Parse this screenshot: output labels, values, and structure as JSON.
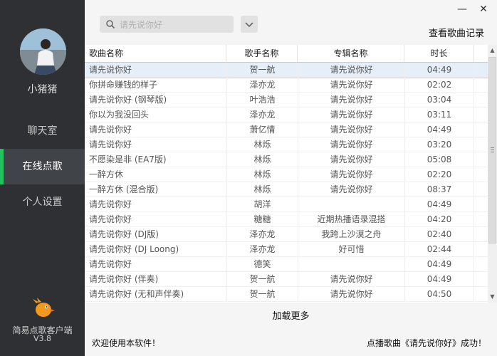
{
  "sidebar": {
    "username": "小猪猪",
    "nav": [
      "聊天室",
      "在线点歌",
      "个人设置"
    ],
    "active_nav": "在线点歌",
    "app_name": "简易点歌客户端",
    "app_version": "V3.8"
  },
  "window": {
    "minimize_label": "—",
    "close_label": "✕"
  },
  "search": {
    "placeholder": "请先说你好"
  },
  "header_link": "查看歌曲记录",
  "table": {
    "columns": [
      "歌曲名称",
      "歌手名称",
      "专辑名称",
      "时长"
    ],
    "rows": [
      [
        "请先说你好",
        "贺一航",
        "请先说你好",
        "04:49"
      ],
      [
        "你拼命赚钱的样子",
        "泽亦龙",
        "请先说你好",
        "02:02"
      ],
      [
        "请先说你好 (钢琴版)",
        "叶浩浩",
        "请先说你好",
        "03:04"
      ],
      [
        "你以为我没回头",
        "泽亦龙",
        "请先说你好",
        "03:11"
      ],
      [
        "请先说你好",
        "萧亿情",
        "请先说你好",
        "04:49"
      ],
      [
        "请先说你好",
        "林烁",
        "请先说你好",
        "03:20"
      ],
      [
        "不愿染是非 (EA7版)",
        "林烁",
        "请先说你好",
        "05:08"
      ],
      [
        "一醉方休",
        "林烁",
        "请先说你好",
        "02:20"
      ],
      [
        "一醉方休 (混合版)",
        "林烁",
        "请先说你好",
        "08:37"
      ],
      [
        "请先说你好",
        "胡洋",
        "",
        "04:49"
      ],
      [
        "请先说你好",
        "糖糖",
        "近期热播语录混搭",
        "04:20"
      ],
      [
        "请先说你好 (DJ版)",
        "泽亦龙",
        "我跨上沙漠之舟",
        "02:40"
      ],
      [
        "请先说你好 (DJ Loong)",
        "泽亦龙",
        "好可惜",
        "02:44"
      ],
      [
        "请先说你好",
        "德笑",
        "",
        "04:49"
      ],
      [
        "请先说你好 (伴奏)",
        "贺一航",
        "请先说你好",
        "04:49"
      ],
      [
        "请先说你好 (无和声伴奏)",
        "贺一航",
        "请先说你好",
        "04:50"
      ]
    ],
    "selected_index": 0
  },
  "load_more": "加载更多",
  "status": {
    "left": "欢迎使用本软件！",
    "right": "点播歌曲《请先说你好》成功！"
  },
  "colors": {
    "sidebar_bg": "#2e3033",
    "active_accent": "#22c35e"
  }
}
